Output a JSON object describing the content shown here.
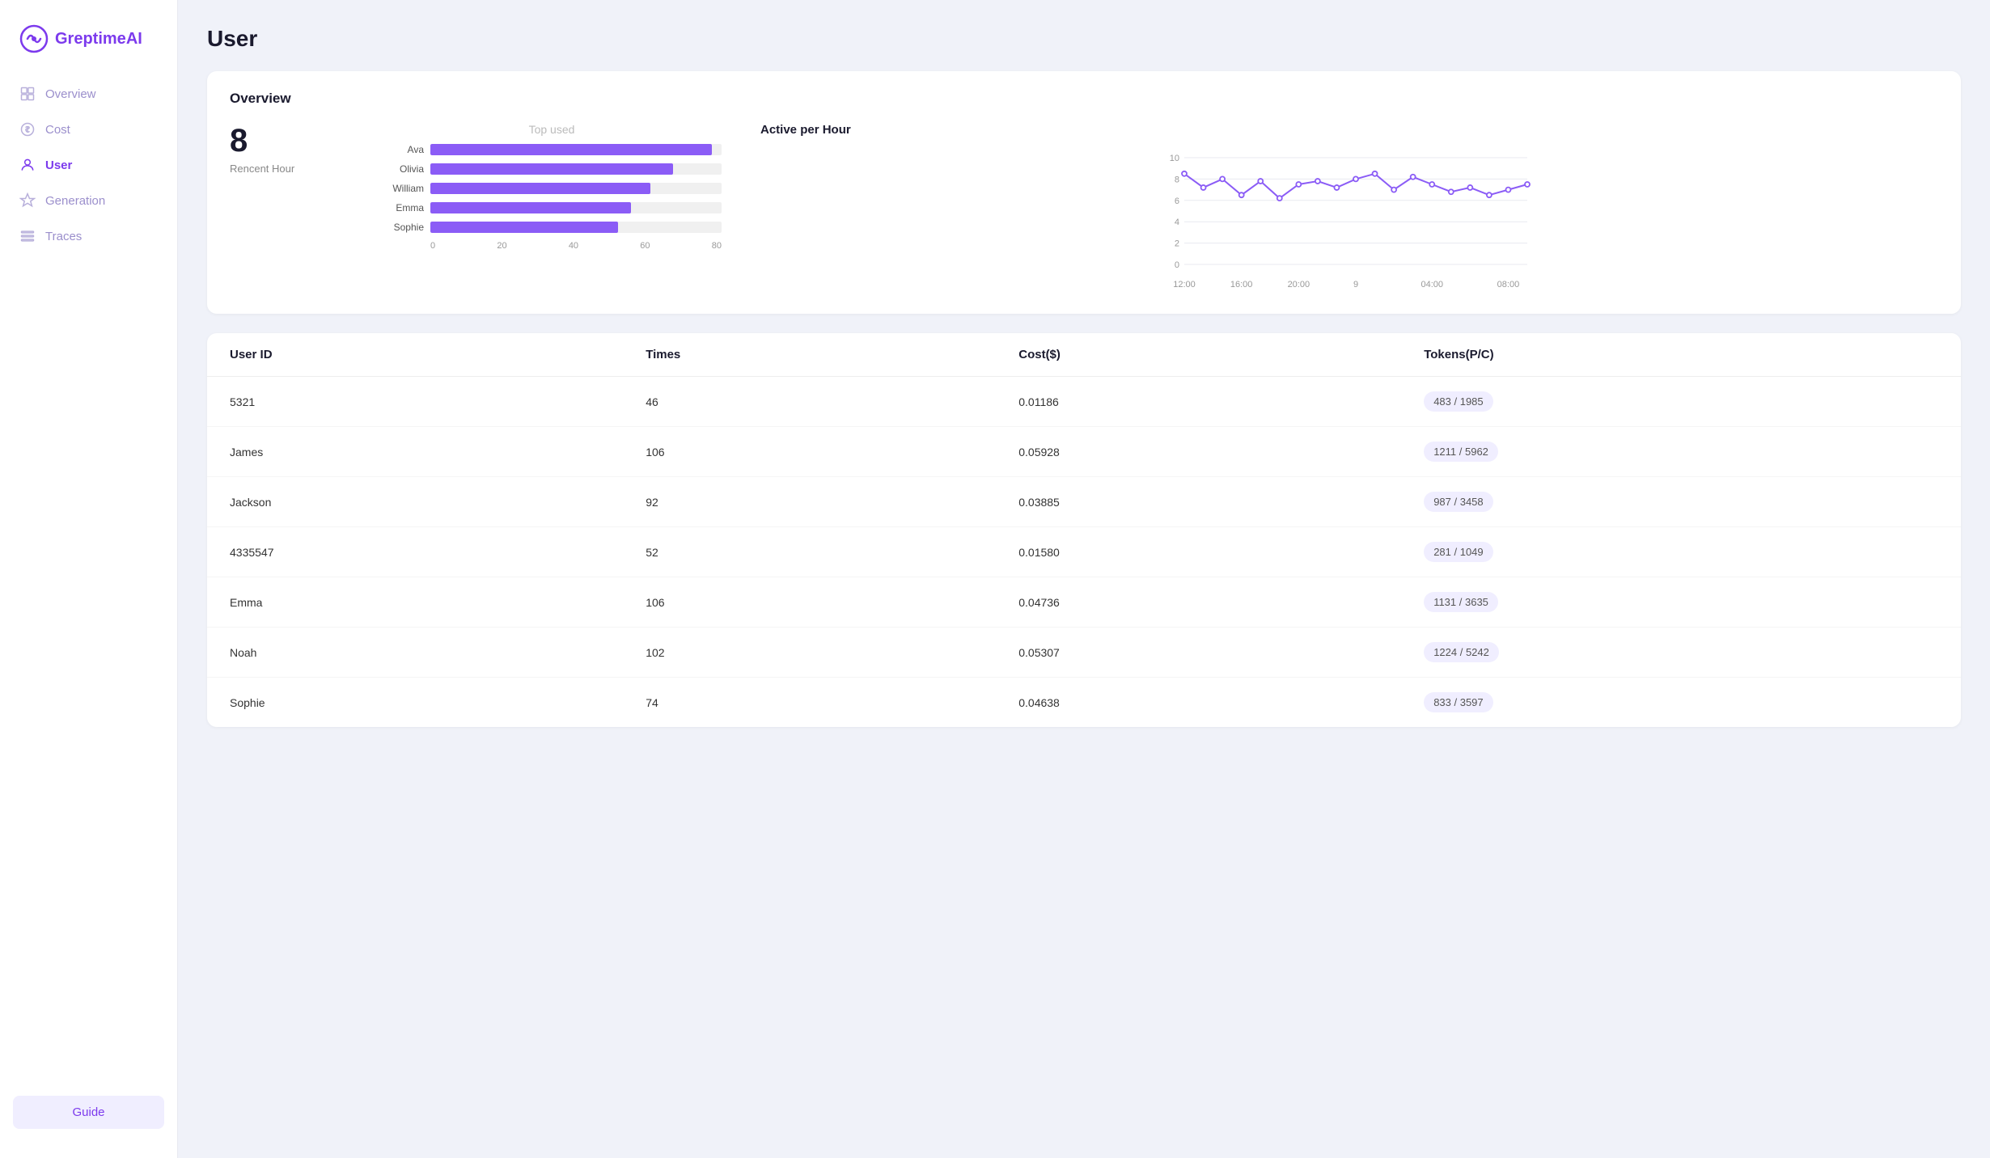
{
  "app": {
    "logo_text": "Greptime",
    "logo_ai": "AI"
  },
  "sidebar": {
    "items": [
      {
        "id": "overview",
        "label": "Overview",
        "icon": "grid-icon"
      },
      {
        "id": "cost",
        "label": "Cost",
        "icon": "dollar-icon"
      },
      {
        "id": "user",
        "label": "User",
        "icon": "user-icon",
        "active": true
      },
      {
        "id": "generation",
        "label": "Generation",
        "icon": "star-icon"
      },
      {
        "id": "traces",
        "label": "Traces",
        "icon": "list-icon"
      }
    ],
    "guide_label": "Guide"
  },
  "page": {
    "title": "User"
  },
  "overview": {
    "title": "Overview",
    "stat_number": "8",
    "stat_label": "Rencent Hour",
    "bar_chart_title": "Top used",
    "bar_items": [
      {
        "label": "Ava",
        "value": 87,
        "max": 90
      },
      {
        "label": "Olivia",
        "value": 75,
        "max": 90
      },
      {
        "label": "William",
        "value": 68,
        "max": 90
      },
      {
        "label": "Emma",
        "value": 62,
        "max": 90
      },
      {
        "label": "Sophie",
        "value": 58,
        "max": 90
      }
    ],
    "bar_axis": [
      "0",
      "20",
      "40",
      "60",
      "80"
    ],
    "line_chart_title": "Active per Hour",
    "line_chart_x_labels": [
      "12:00",
      "16:00",
      "20:00",
      "9",
      "04:00",
      "08:00"
    ],
    "line_chart_y_labels": [
      "0",
      "2",
      "4",
      "6",
      "8",
      "10"
    ],
    "line_chart_points": [
      {
        "x": 0,
        "y": 8.5
      },
      {
        "x": 1,
        "y": 7.2
      },
      {
        "x": 2,
        "y": 8.0
      },
      {
        "x": 3,
        "y": 6.5
      },
      {
        "x": 4,
        "y": 7.8
      },
      {
        "x": 5,
        "y": 6.2
      },
      {
        "x": 6,
        "y": 7.5
      },
      {
        "x": 7,
        "y": 7.8
      },
      {
        "x": 8,
        "y": 7.2
      },
      {
        "x": 9,
        "y": 8.0
      },
      {
        "x": 10,
        "y": 8.5
      },
      {
        "x": 11,
        "y": 7.0
      },
      {
        "x": 12,
        "y": 8.2
      },
      {
        "x": 13,
        "y": 7.5
      },
      {
        "x": 14,
        "y": 6.8
      },
      {
        "x": 15,
        "y": 7.2
      },
      {
        "x": 16,
        "y": 6.5
      },
      {
        "x": 17,
        "y": 7.0
      },
      {
        "x": 18,
        "y": 7.5
      }
    ]
  },
  "table": {
    "columns": [
      "User ID",
      "Times",
      "Cost($)",
      "Tokens(P/C)"
    ],
    "rows": [
      {
        "user_id": "5321",
        "times": "46",
        "cost": "0.01186",
        "tokens": "483 / 1985"
      },
      {
        "user_id": "James",
        "times": "106",
        "cost": "0.05928",
        "tokens": "1211 / 5962"
      },
      {
        "user_id": "Jackson",
        "times": "92",
        "cost": "0.03885",
        "tokens": "987 / 3458"
      },
      {
        "user_id": "4335547",
        "times": "52",
        "cost": "0.01580",
        "tokens": "281 / 1049"
      },
      {
        "user_id": "Emma",
        "times": "106",
        "cost": "0.04736",
        "tokens": "1131 / 3635"
      },
      {
        "user_id": "Noah",
        "times": "102",
        "cost": "0.05307",
        "tokens": "1224 / 5242"
      },
      {
        "user_id": "Sophie",
        "times": "74",
        "cost": "0.04638",
        "tokens": "833 / 3597"
      }
    ]
  }
}
